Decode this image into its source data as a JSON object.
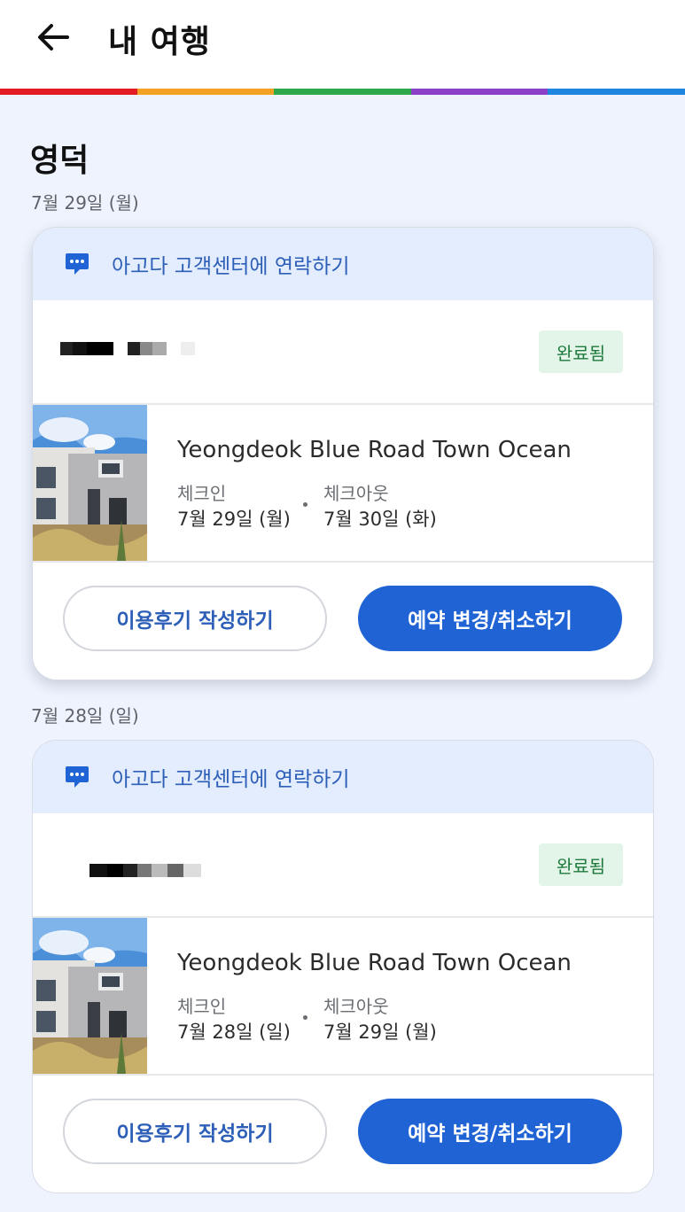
{
  "app_bar": {
    "title": "내 여행"
  },
  "colors": {
    "rainbow": [
      "#e31b23",
      "#f4a224",
      "#2ea84a",
      "#8c3fc7",
      "#1f86e0"
    ],
    "primary": "#1f63d5",
    "link": "#2e5fb8",
    "status_bg": "#e3f4e8",
    "status_text": "#1e7a3c"
  },
  "city": "영덕",
  "bookings": [
    {
      "date": "7월 29일 (월)",
      "contact_label": "아고다 고객센터에 연락하기",
      "status": "완료됨",
      "hotel_name": "Yeongdeok Blue Road Town Ocean",
      "checkin_label": "체크인",
      "checkin_date": "7월 29일 (월)",
      "checkout_label": "체크아웃",
      "checkout_date": "7월 30일 (화)",
      "review_button": "이용후기 작성하기",
      "change_button": "예약 변경/취소하기"
    },
    {
      "date": "7월 28일 (일)",
      "contact_label": "아고다 고객센터에 연락하기",
      "status": "완료됨",
      "hotel_name": "Yeongdeok Blue Road Town Ocean",
      "checkin_label": "체크인",
      "checkin_date": "7월 28일 (일)",
      "checkout_label": "체크아웃",
      "checkout_date": "7월 29일 (월)",
      "review_button": "이용후기 작성하기",
      "change_button": "예약 변경/취소하기"
    }
  ],
  "icons": {
    "back": "arrow-left-icon",
    "contact": "chat-bubble-icon"
  }
}
